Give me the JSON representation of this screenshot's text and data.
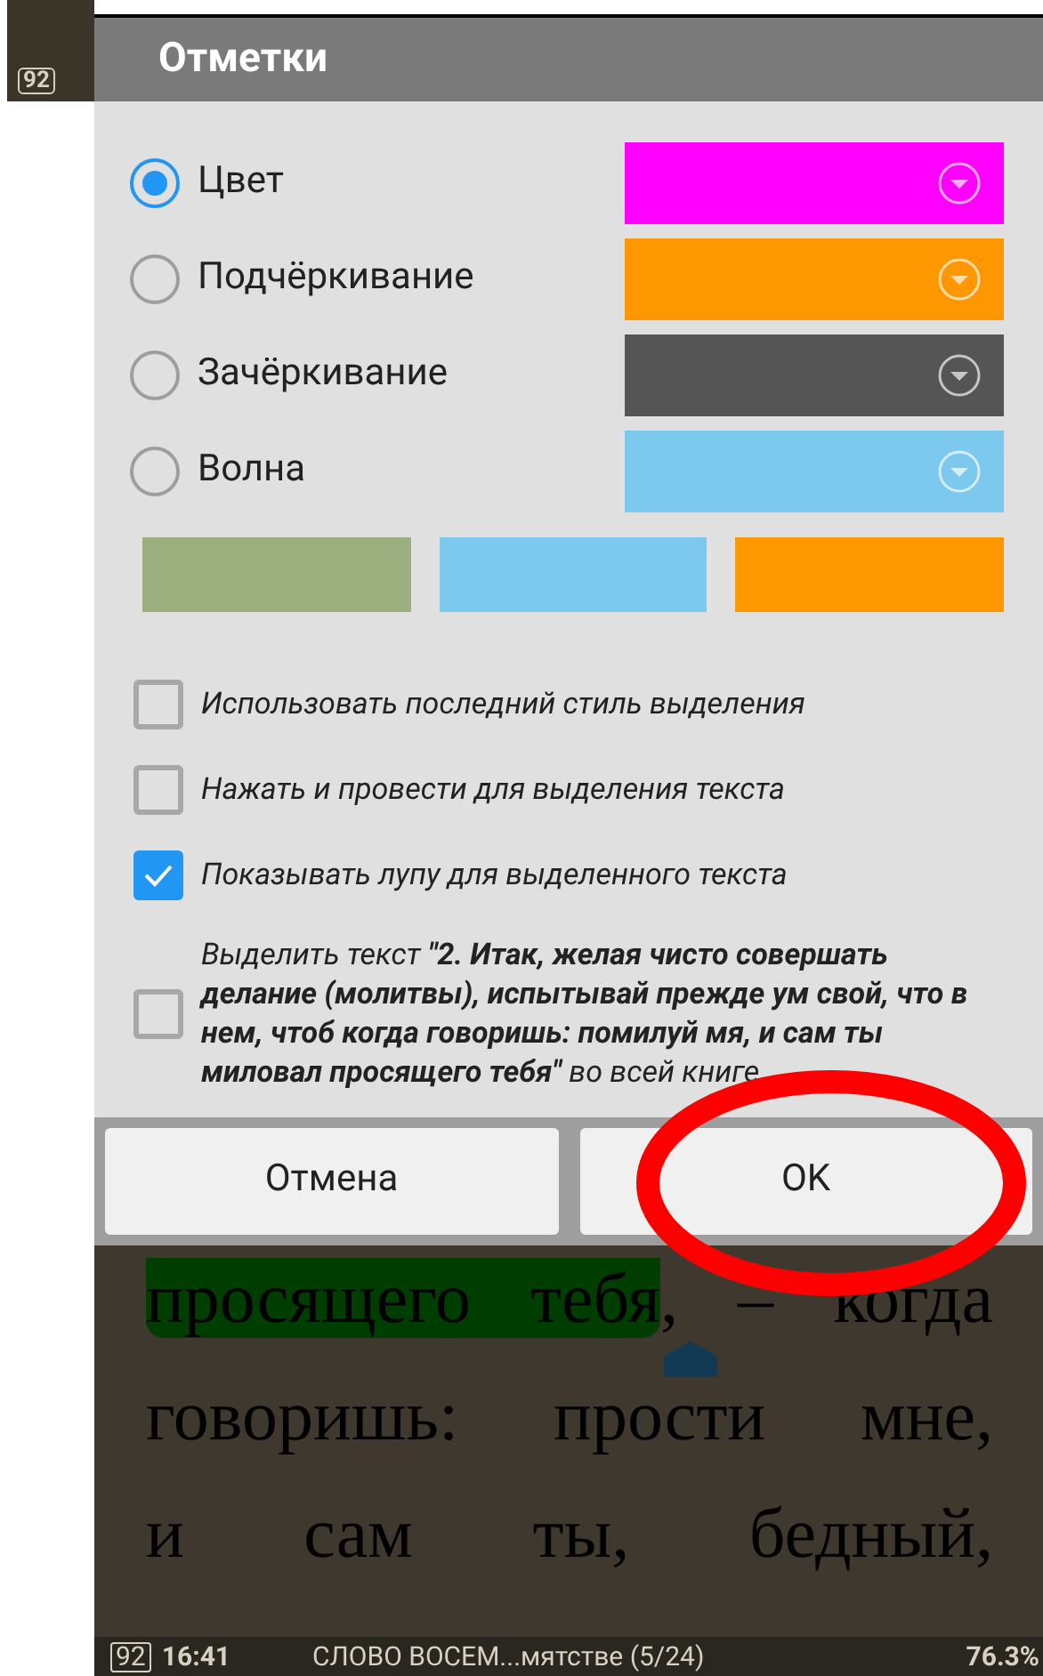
{
  "side_strip": {
    "battery": "92"
  },
  "dialog": {
    "title": "Отметки",
    "styles": [
      {
        "label": "Цвет",
        "selected": true,
        "color": "#ff00ff"
      },
      {
        "label": "Подчёркивание",
        "selected": false,
        "color": "#ff9800"
      },
      {
        "label": "Зачёркивание",
        "selected": false,
        "color": "#555555"
      },
      {
        "label": "Волна",
        "selected": false,
        "color": "#7cc8ee"
      }
    ],
    "palette": [
      {
        "color": "#9caf7e"
      },
      {
        "color": "#7cc8ee"
      },
      {
        "color": "#ff9800"
      }
    ],
    "options": [
      {
        "label": "Использовать последний стиль выделения",
        "checked": false
      },
      {
        "label": "Нажать и провести для выделения текста",
        "checked": false
      },
      {
        "label": "Показывать лупу для выделенного текста",
        "checked": true
      },
      {
        "label": "Выделить текст **\"2. Итак, желая чисто совершать делание (молитвы), испытывай прежде ум свой, что в нем, чтоб когда говоришь: помилуй мя, и сам ты миловал просящего тебя\"** во всей книге",
        "checked": false
      }
    ],
    "buttons": [
      "Отмена",
      "OK"
    ]
  },
  "book": {
    "lines": [
      {
        "highlight": "просящего тебя",
        "rest": ", – когда"
      },
      {
        "rest": "говоришь: прости мне,"
      },
      {
        "rest": "и сам ты, бедный,"
      }
    ]
  },
  "status_bar": {
    "battery": "92",
    "time": "16:41",
    "chapter": "СЛОВО ВОСЕМ...мятстве (5/24)",
    "progress": "76.3%"
  }
}
